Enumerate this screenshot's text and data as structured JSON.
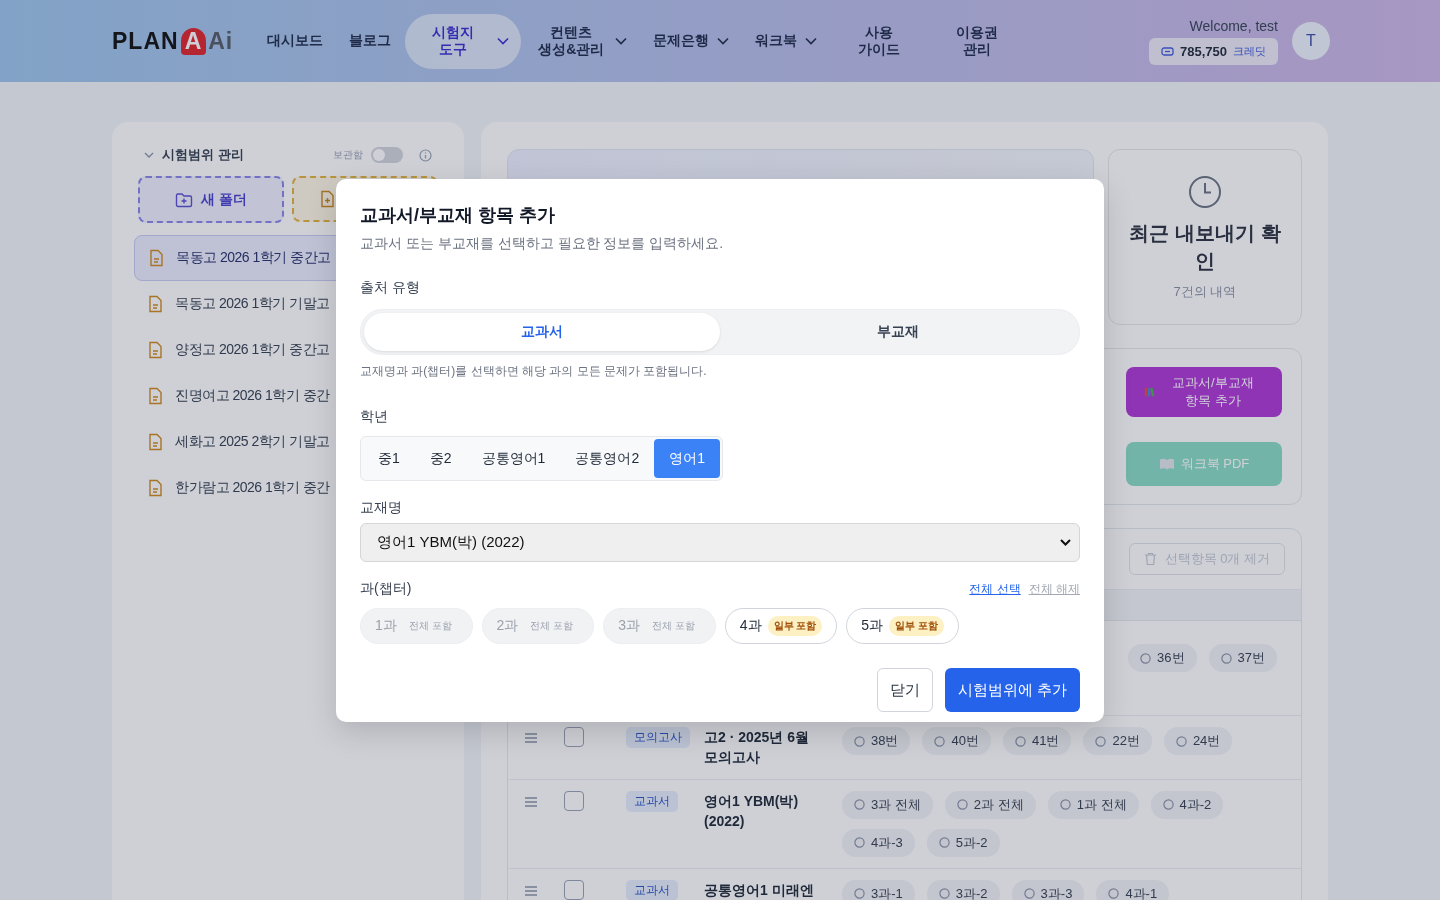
{
  "header": {
    "logo": [
      "PLAN",
      "A",
      "Ai"
    ],
    "nav": [
      {
        "label": "대시보드",
        "selected": false,
        "dropdown": false
      },
      {
        "label": "블로그",
        "selected": false,
        "dropdown": false
      },
      {
        "label": "시험지 도구",
        "selected": true,
        "dropdown": true
      },
      {
        "label": "컨텐츠 생성&관리",
        "selected": false,
        "dropdown": true
      },
      {
        "label": "문제은행",
        "selected": false,
        "dropdown": true
      },
      {
        "label": "워크북",
        "selected": false,
        "dropdown": true
      },
      {
        "label": "사용 가이드",
        "selected": false,
        "dropdown": false
      },
      {
        "label": "이용권 관리",
        "selected": false,
        "dropdown": false
      }
    ],
    "welcome": "Welcome, test",
    "credits": "785,750",
    "credits_unit": "크레딧",
    "avatar": "T"
  },
  "sidebar": {
    "title": "시험범위 관리",
    "archive_label": "보관함",
    "archive_on": false,
    "buttons": [
      {
        "kind": "folder",
        "label": "새 폴더"
      },
      {
        "kind": "file"
      }
    ],
    "files": [
      {
        "name": "목동고 2026 1학기 중간고",
        "selected": true
      },
      {
        "name": "목동고 2026 1학기 기말고",
        "selected": false
      },
      {
        "name": "양정고 2026 1학기 중간고",
        "selected": false
      },
      {
        "name": "진명여고 2026 1학기 중간",
        "selected": false
      },
      {
        "name": "세화고 2025 2학기 기말고",
        "selected": false
      },
      {
        "name": "한가람고 2026 1학기 중간",
        "selected": false
      }
    ]
  },
  "recent": {
    "title": "최근 내보내기 확인",
    "subtitle": "7건의 내역"
  },
  "actions": [
    {
      "kind": "add",
      "label": "교과서/부교재 항목 추가"
    },
    {
      "kind": "pdf",
      "label": "워크북 PDF"
    }
  ],
  "table": {
    "remove_button": {
      "label": "선택항목 0개 제거",
      "disabled": true
    },
    "rows": [
      {
        "chips": [
          "36번",
          "37번"
        ]
      },
      {
        "tag": "모의고사",
        "title": "고2 · 2025년 6월 모의고사",
        "checked": false,
        "chips": [
          "38번",
          "40번",
          "41번",
          "22번",
          "24번"
        ]
      },
      {
        "tag": "교과서",
        "title": "영어1 YBM(박) (2022)",
        "checked": false,
        "chips": [
          "3과 전체",
          "2과 전체",
          "1과 전체",
          "4과-2",
          "4과-3",
          "5과-2"
        ]
      },
      {
        "tag": "교과서",
        "title": "공통영어1 미래엔",
        "checked": false,
        "chips": [
          "3과-1",
          "3과-2",
          "3과-3",
          "4과-1"
        ]
      }
    ]
  },
  "modal": {
    "title": "교과서/부교재 항목 추가",
    "subtitle": "교과서 또는 부교재를 선택하고 필요한 정보를 입력하세요.",
    "source_label": "출처 유형",
    "source_options": [
      {
        "label": "교과서",
        "selected": true
      },
      {
        "label": "부교재",
        "selected": false
      }
    ],
    "hint": "교재명과 과(챕터)를 선택하면 해당 과의 모든 문제가 포함됩니다.",
    "grade_label": "학년",
    "grades": [
      {
        "label": "중1",
        "selected": false
      },
      {
        "label": "중2",
        "selected": false
      },
      {
        "label": "공통영어1",
        "selected": false
      },
      {
        "label": "공통영어2",
        "selected": false
      },
      {
        "label": "영어1",
        "selected": true
      }
    ],
    "book_label": "교재명",
    "book_value": "영어1 YBM(박) (2022)",
    "chapter_label": "과(챕터)",
    "select_all": "전체 선택",
    "deselect_all": {
      "label": "전체 해제",
      "disabled": true
    },
    "chapters": [
      {
        "label": "1과",
        "badge": "전체 포함",
        "kind": "full",
        "disabled": true
      },
      {
        "label": "2과",
        "badge": "전체 포함",
        "kind": "full",
        "disabled": true
      },
      {
        "label": "3과",
        "badge": "전체 포함",
        "kind": "full",
        "disabled": true
      },
      {
        "label": "4과",
        "badge": "일부 포함",
        "kind": "partial",
        "disabled": false
      },
      {
        "label": "5과",
        "badge": "일부 포함",
        "kind": "partial",
        "disabled": false
      }
    ],
    "close": "닫기",
    "submit": "시험범위에 추가"
  }
}
